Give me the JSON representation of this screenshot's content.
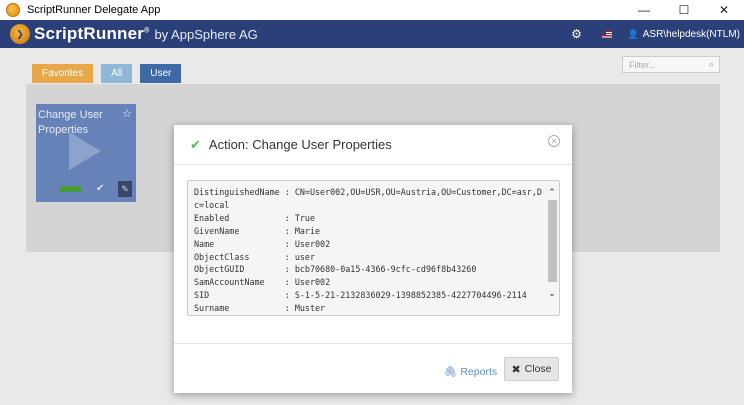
{
  "window": {
    "title": "ScriptRunner Delegate App",
    "minimize": "—",
    "maximize": "☐",
    "close": "✕"
  },
  "header": {
    "brand_name": "ScriptRunner",
    "brand_trademark": "®",
    "brand_by": "by AppSphere AG",
    "user": "ASR\\helpdesk(NTLM)",
    "icons": [
      "gear-icon",
      "us-flag-icon",
      "user-icon"
    ]
  },
  "tabs": [
    {
      "label": "Favorites",
      "color": "#e8a84a"
    },
    {
      "label": "All",
      "color": "#8fb7d8"
    },
    {
      "label": "User",
      "color": "#3d6aa4"
    }
  ],
  "filter": {
    "placeholder": "Filter..."
  },
  "tile": {
    "title": "Change User Properties",
    "icons": [
      "star-icon",
      "play-icon",
      "check-icon",
      "paperclip-icon"
    ]
  },
  "modal": {
    "title": "Action: Change User Properties",
    "output_lines": [
      "DistinguishedName : CN=User002,OU=USR,OU=Austria,OU=Customer,DC=asr,D",
      "c=local",
      "Enabled           : True",
      "GivenName         : Marie",
      "Name              : User002",
      "ObjectClass       : user",
      "ObjectGUID        : bcb70680-0a15-4366-9cfc-cd96f8b43260",
      "SamAccountName    : User002",
      "SID               : S-1-5-21-2132836029-1398852385-4227704496-2114",
      "Surname           : Muster"
    ],
    "reports_label": "Reports",
    "close_label": "Close"
  },
  "colors": {
    "appbar": "#2b3f78",
    "success": "#5cb85c",
    "link": "#5b8fc9"
  }
}
